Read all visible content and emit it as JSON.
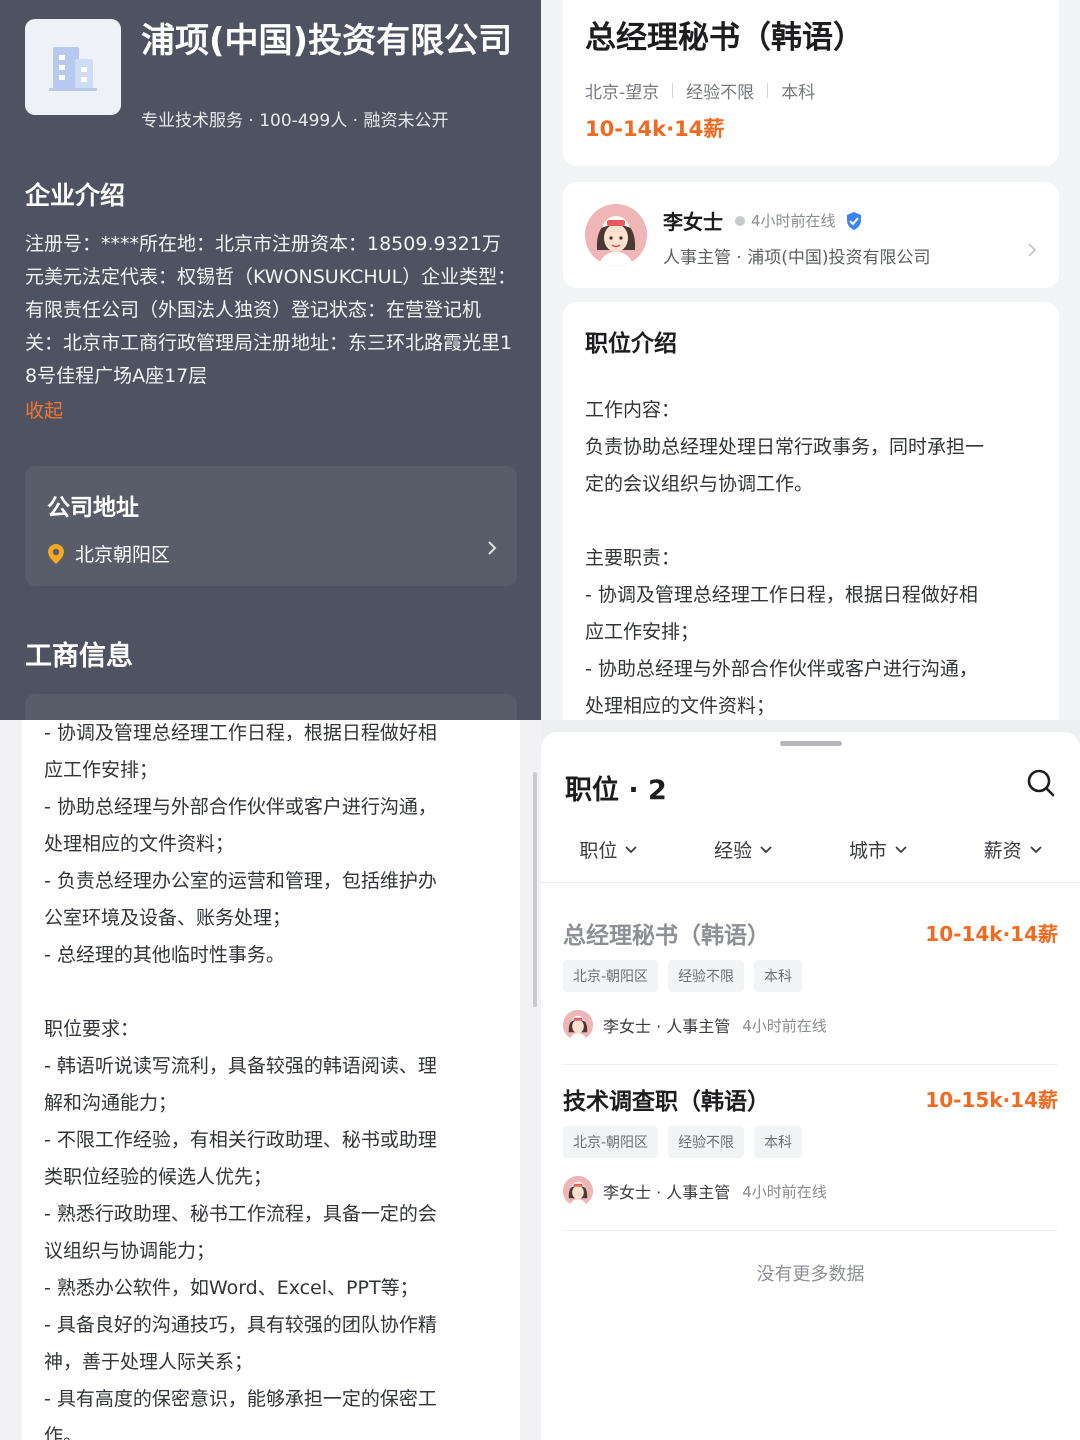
{
  "company": {
    "name": "浦项(中国)投资有限公司",
    "meta": "专业技术服务 · 100-499人 · 融资未公开",
    "intro_title": "企业介绍",
    "intro_text": "注册号：****所在地：北京市注册资本：18509.9321万元美元法定代表：权锡哲（KWONSUKCHUL）企业类型：有限责任公司（外国法人独资）登记状态：在营登记机关：北京市工商行政管理局注册地址：东三环北路霞光里18号佳程广场A座17层",
    "collapse_label": "收起",
    "address_title": "公司地址",
    "address": "北京朝阳区",
    "business_info_title": "工商信息"
  },
  "job": {
    "title": "总经理秘书（韩语）",
    "location": "北京-望京",
    "experience": "经验不限",
    "education": "本科",
    "salary": "10-14k·14薪",
    "recruiter": {
      "name": "李女士",
      "online": "4小时前在线",
      "subtitle": "人事主管 · 浦项(中国)投资有限公司"
    },
    "description_title": "职位介绍",
    "description_lines": [
      "工作内容：",
      "负责协助总经理处理日常行政事务，同时承担一",
      "定的会议组织与协调工作。",
      "",
      "主要职责：",
      "- 协调及管理总经理工作日程，根据日程做好相",
      "应工作安排；",
      "- 协助总经理与外部合作伙伴或客户进行沟通，",
      "处理相应的文件资料；"
    ],
    "description_more_lines": [
      "- 协调及管理总经理工作日程，根据日程做好相",
      "应工作安排；",
      "- 协助总经理与外部合作伙伴或客户进行沟通，",
      "处理相应的文件资料；",
      "- 负责总经理办公室的运营和管理，包括维护办",
      "公室环境及设备、账务处理；",
      "- 总经理的其他临时性事务。",
      "",
      "职位要求：",
      "- 韩语听说读写流利，具备较强的韩语阅读、理",
      "解和沟通能力；",
      "- 不限工作经验，有相关行政助理、秘书或助理",
      "类职位经验的候选人优先；",
      "- 熟悉行政助理、秘书工作流程，具备一定的会",
      "议组织与协调能力；",
      "- 熟悉办公软件，如Word、Excel、PPT等；",
      "- 具备良好的沟通技巧，具有较强的团队协作精",
      "神，善于处理人际关系；",
      "- 具有高度的保密意识，能够承担一定的保密工",
      "作。"
    ]
  },
  "jobs_list": {
    "title": "职位 · 2",
    "filters": [
      "职位",
      "经验",
      "城市",
      "薪资"
    ],
    "items": [
      {
        "title": "总经理秘书（韩语）",
        "title_color": "#8e9096",
        "salary": "10-14k·14薪",
        "tags": [
          "北京-朝阳区",
          "经验不限",
          "本科"
        ],
        "recruiter": "李女士 · 人事主管",
        "online": "4小时前在线"
      },
      {
        "title": "技术调查职（韩语）",
        "title_color": "#1d1d1f",
        "salary": "10-15k·14薪",
        "tags": [
          "北京-朝阳区",
          "经验不限",
          "本科"
        ],
        "recruiter": "李女士 · 人事主管",
        "online": "4小时前在线"
      }
    ],
    "no_more": "没有更多数据"
  },
  "colors": {
    "accent": "#f06a21",
    "dark_panel": "#4f5260",
    "verified": "#3b82f6"
  },
  "icons": [
    "building-icon",
    "location-pin-icon",
    "chevron-right-icon",
    "verified-badge-icon",
    "search-icon",
    "chevron-down-icon",
    "avatar"
  ]
}
